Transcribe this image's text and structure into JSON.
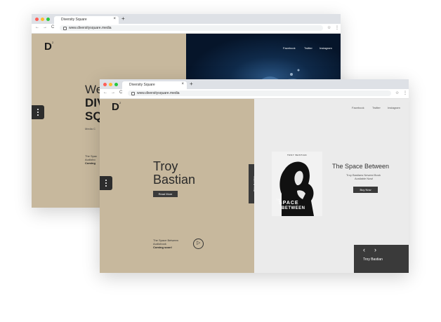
{
  "back_window": {
    "tab_title": "Diversity Square",
    "url": "www.diversitysquare.media",
    "nav": [
      "Facebook",
      "Twitter",
      "Instagram"
    ],
    "hero_line1": "We",
    "hero_line2": "DIV",
    "hero_line3": "SQ",
    "hero_sub": "Media C",
    "promo_line1": "The Spac",
    "promo_line2": "Audiobo",
    "promo_line3": "Coming"
  },
  "front_window": {
    "tab_title": "Diversity Square",
    "url": "www.diversitysquare.media",
    "nav": [
      "Facebook",
      "Twitter",
      "Instagram"
    ],
    "author_first": "Troy",
    "author_last": "Bastian",
    "read_more": "Read More",
    "promo_line1": "The Space Between",
    "promo_line2": "Audiobook",
    "promo_line3": "Coming soon!",
    "vertical_tab": "Troy Bastian",
    "book_title": "The Space Between",
    "book_sub1": "Troy Bastians Newest Book",
    "book_sub2": "Available Now!",
    "buy_now": "Buy Now",
    "cover_top": "TROY BASTIAN",
    "cover_the": "THE",
    "cover_space": "SPACE",
    "cover_between": "BETWEEN",
    "carousel_label": "Troy Bastian"
  },
  "icons": {
    "logo": "D",
    "logo_sup": "2",
    "new_tab": "+",
    "close": "×",
    "back": "←",
    "forward": "→",
    "reload": "C",
    "star": "☆",
    "menu": "⋮",
    "prev": "‹",
    "next": "›",
    "play": "▷"
  },
  "colors": {
    "beige": "#c7b89d",
    "dark": "#3a3a3a",
    "light_panel": "#ebebeb",
    "traffic_red": "#ff5f57",
    "traffic_yellow": "#febc2e",
    "traffic_green": "#28c840"
  }
}
